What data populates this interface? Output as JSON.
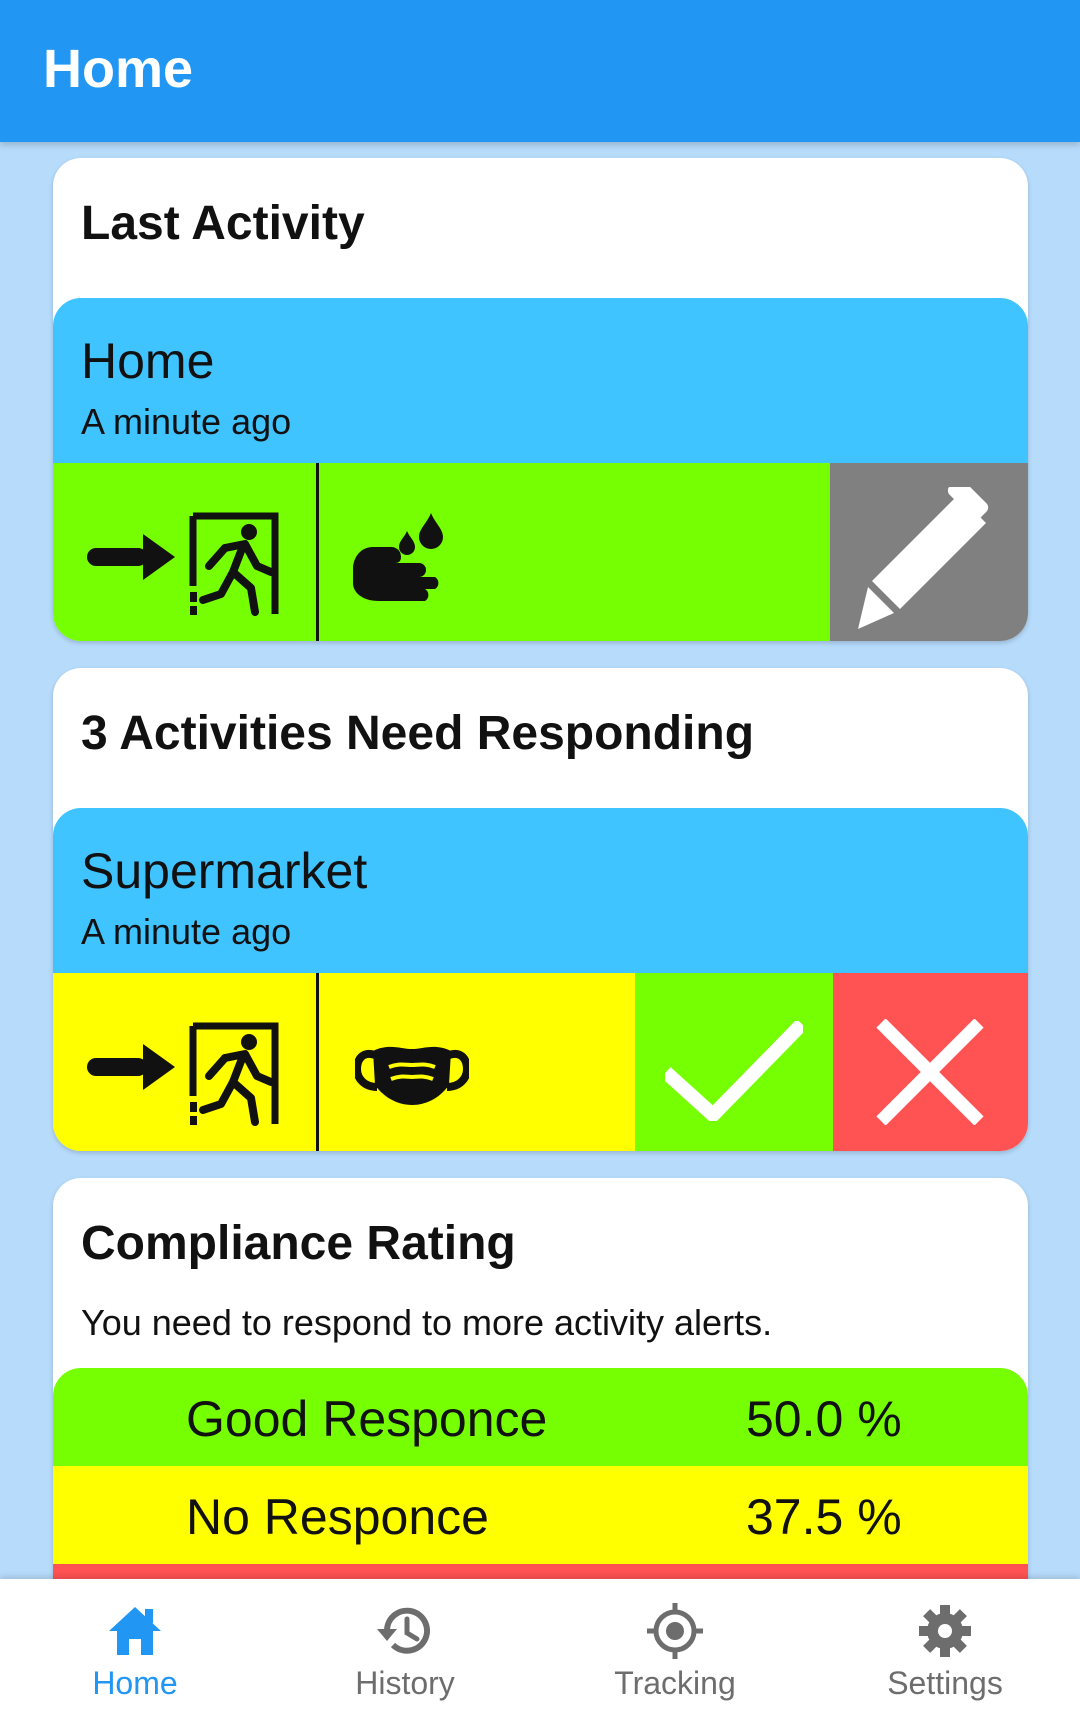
{
  "appbar": {
    "title": "Home"
  },
  "last_activity": {
    "title": "Last Activity",
    "place": "Home",
    "time": "A minute ago",
    "entry_icon": "enter-door-icon",
    "action_icon": "hand-wash-icon",
    "edit_icon": "pencil-icon",
    "row_color": "#76ff03",
    "edit_color": "#808080"
  },
  "pending": {
    "title": "3 Activities Need Responding",
    "place": "Supermarket",
    "time": "A minute ago",
    "entry_icon": "enter-door-icon",
    "action_icon": "face-mask-icon",
    "confirm_icon": "check-icon",
    "reject_icon": "close-icon",
    "row_color": "#ffff00",
    "confirm_color": "#76ff03",
    "reject_color": "#ff5252"
  },
  "compliance": {
    "title": "Compliance Rating",
    "note": "You need to respond to more activity alerts.",
    "rows": [
      {
        "label": "Good Responce",
        "value": "50.0 %",
        "color": "#76ff03"
      },
      {
        "label": "No Responce",
        "value": "37.5 %",
        "color": "#ffff00"
      }
    ],
    "next_row_color": "#ff5252"
  },
  "colors": {
    "primary": "#2196f3",
    "background": "#b7dbfb",
    "activity_header": "#40c4ff"
  },
  "bottom_nav": {
    "items": [
      {
        "label": "Home",
        "icon": "home-icon",
        "active": true
      },
      {
        "label": "History",
        "icon": "history-icon",
        "active": false
      },
      {
        "label": "Tracking",
        "icon": "gps-target-icon",
        "active": false
      },
      {
        "label": "Settings",
        "icon": "gear-icon",
        "active": false
      }
    ]
  }
}
